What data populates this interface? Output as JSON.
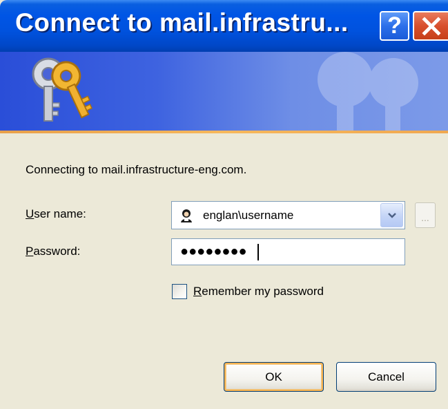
{
  "window": {
    "title": "Connect to mail.infrastru...",
    "help_label": "?",
    "close_label": "✕"
  },
  "banner": {
    "icon": "keys-icon"
  },
  "body": {
    "connecting_text": "Connecting to mail.infrastructure-eng.com."
  },
  "form": {
    "username_label_accel": "U",
    "username_label_rest": "ser name:",
    "username_value": "englan\\username",
    "password_label_accel": "P",
    "password_label_rest": "assword:",
    "password_mask": "●●●●●●●●",
    "browse_label": "...",
    "remember_accel": "R",
    "remember_rest": "emember my password",
    "remember_checked": false
  },
  "buttons": {
    "ok_label": "OK",
    "cancel_label": "Cancel"
  },
  "colors": {
    "titlebar": "#0055E5",
    "dialog_bg": "#ECE9D8",
    "accent_stripe": "#F6B85C"
  }
}
